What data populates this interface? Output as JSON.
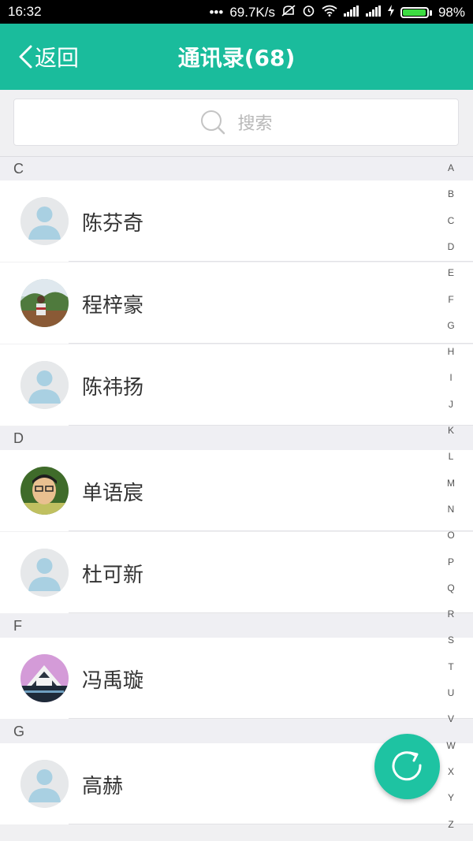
{
  "status_bar": {
    "time": "16:32",
    "network_speed": "69.7K/s",
    "battery": "98%",
    "battery_level": 0.98,
    "icons": [
      "more-dots-icon",
      "mute-icon",
      "alarm-icon",
      "wifi-icon",
      "signal-icon",
      "signal-icon",
      "charging-icon",
      "battery-icon"
    ]
  },
  "header": {
    "back_label": "返回",
    "title": "通讯录(68)",
    "background": "#1abc9c"
  },
  "search": {
    "placeholder": "搜索"
  },
  "sections": [
    {
      "letter": "C",
      "contacts": [
        {
          "name": "陈芬奇",
          "avatar": "default-avatar"
        },
        {
          "name": "程梓豪",
          "avatar": "photo-avatar"
        },
        {
          "name": "陈祎扬",
          "avatar": "default-avatar"
        }
      ]
    },
    {
      "letter": "D",
      "contacts": [
        {
          "name": "单语宸",
          "avatar": "photo-avatar"
        },
        {
          "name": "杜可新",
          "avatar": "default-avatar"
        }
      ]
    },
    {
      "letter": "F",
      "contacts": [
        {
          "name": "冯禹璇",
          "avatar": "photo-avatar"
        }
      ]
    },
    {
      "letter": "G",
      "contacts": [
        {
          "name": "高赫",
          "avatar": "default-avatar"
        }
      ]
    }
  ],
  "alphabet_index": [
    "A",
    "B",
    "C",
    "D",
    "E",
    "F",
    "G",
    "H",
    "I",
    "J",
    "K",
    "L",
    "M",
    "N",
    "O",
    "P",
    "Q",
    "R",
    "S",
    "T",
    "U",
    "V",
    "W",
    "X",
    "Y",
    "Z"
  ],
  "fab": {
    "icon": "refresh-icon",
    "color": "#1ec3a2"
  }
}
